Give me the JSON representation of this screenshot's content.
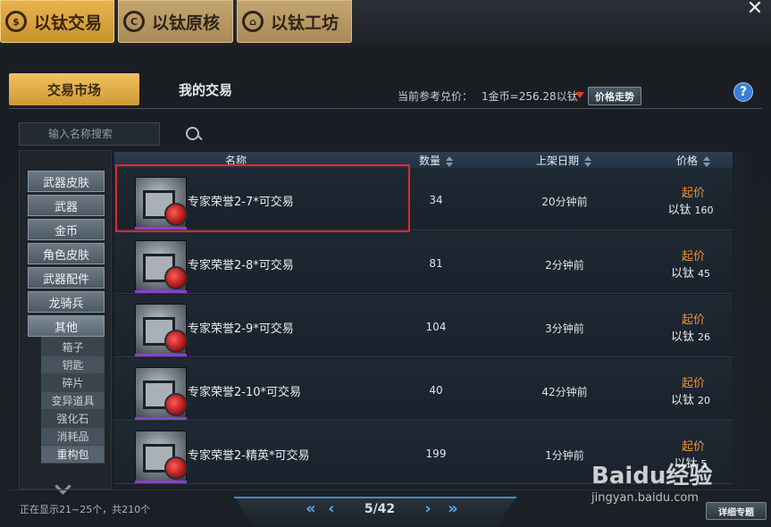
{
  "top_tabs": [
    {
      "label": "以钛交易",
      "icon": "coin-icon"
    },
    {
      "label": "以钛原核",
      "icon": "core-icon"
    },
    {
      "label": "以钛工坊",
      "icon": "house-icon"
    }
  ],
  "close_label": "✕",
  "sub_tabs": {
    "market": "交易市场",
    "mine": "我的交易"
  },
  "rate": {
    "label": "当前参考兑价：",
    "value": "1金币=256.28以钛"
  },
  "trend_button": "价格走势",
  "help_label": "?",
  "search": {
    "placeholder": "输入名称搜索"
  },
  "categories": [
    "武器皮肤",
    "武器",
    "金币",
    "角色皮肤",
    "武器配件",
    "龙骑兵",
    "其他"
  ],
  "subcategories": [
    "箱子",
    "钥匙",
    "碎片",
    "变异道具",
    "强化石",
    "消耗品",
    "重构包"
  ],
  "table": {
    "headers": {
      "name": "名称",
      "qty": "数量",
      "date": "上架日期",
      "price": "价格"
    },
    "price_label": "起价",
    "currency": "以钛",
    "rows": [
      {
        "name": "专家荣誉2-7*可交易",
        "qty": "34",
        "date": "20分钟前",
        "price": "160"
      },
      {
        "name": "专家荣誉2-8*可交易",
        "qty": "81",
        "date": "2分钟前",
        "price": "45"
      },
      {
        "name": "专家荣誉2-9*可交易",
        "qty": "104",
        "date": "3分钟前",
        "price": "26"
      },
      {
        "name": "专家荣誉2-10*可交易",
        "qty": "40",
        "date": "42分钟前",
        "price": "20"
      },
      {
        "name": "专家荣誉2-精英*可交易",
        "qty": "199",
        "date": "1分钟前",
        "price": "5"
      }
    ]
  },
  "status": "正在显示21~25个，共210个",
  "pager": {
    "first": "«",
    "prev": "‹",
    "page": "5/42",
    "next": "›",
    "last": "»"
  },
  "detail_button": "详细专题",
  "watermark": {
    "text": "Baidu经验",
    "url": "jingyan.baidu.com"
  },
  "colors": {
    "accent_gold": "#e8b44e",
    "price_orange": "#f0922e",
    "highlight_red": "#e5262a",
    "pager_blue": "#5fa3e6"
  }
}
